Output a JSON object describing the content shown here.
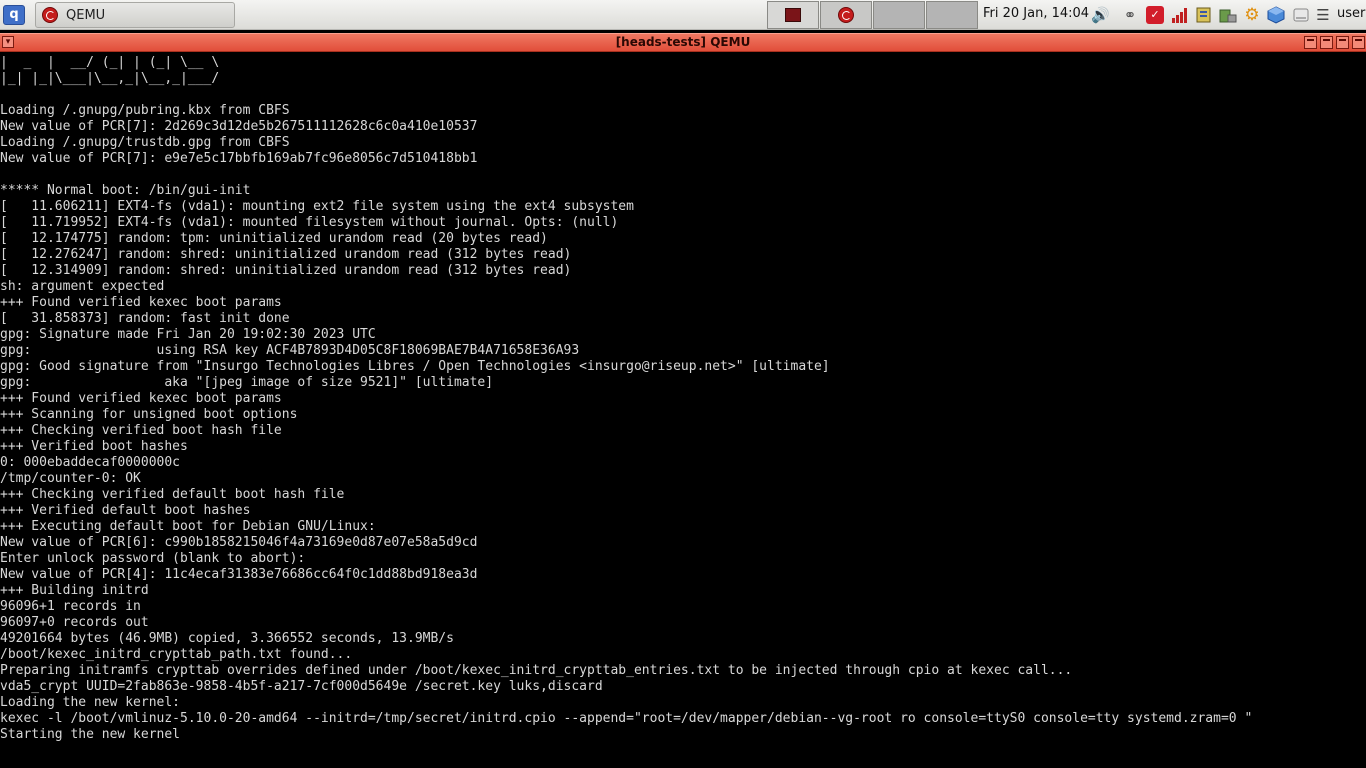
{
  "taskbar": {
    "menu_icon": "q",
    "task": {
      "label": "QEMU",
      "icon": "qemu-logo-icon"
    },
    "clock": "Fri 20 Jan, 14:04",
    "tray_icons": [
      "volume-icon",
      "lock-icon",
      "shield-icon",
      "network-signal-icon",
      "clipboard-icon",
      "keyboard-icon",
      "settings-gear-icon",
      "package-icon",
      "drive-icon",
      "list-icon"
    ],
    "user": "user"
  },
  "window": {
    "title": "[heads-tests] QEMU"
  },
  "terminal": {
    "lines": [
      "|  _  |  __/ (_| | (_| \\__ \\",
      "|_| |_|\\___|\\__,_|\\__,_|___/",
      "",
      "Loading /.gnupg/pubring.kbx from CBFS",
      "New value of PCR[7]: 2d269c3d12de5b267511112628c6c0a410e10537",
      "Loading /.gnupg/trustdb.gpg from CBFS",
      "New value of PCR[7]: e9e7e5c17bbfb169ab7fc96e8056c7d510418bb1",
      "",
      "***** Normal boot: /bin/gui-init",
      "[   11.606211] EXT4-fs (vda1): mounting ext2 file system using the ext4 subsystem",
      "[   11.719952] EXT4-fs (vda1): mounted filesystem without journal. Opts: (null)",
      "[   12.174775] random: tpm: uninitialized urandom read (20 bytes read)",
      "[   12.276247] random: shred: uninitialized urandom read (312 bytes read)",
      "[   12.314909] random: shred: uninitialized urandom read (312 bytes read)",
      "sh: argument expected",
      "+++ Found verified kexec boot params",
      "[   31.858373] random: fast init done",
      "gpg: Signature made Fri Jan 20 19:02:30 2023 UTC",
      "gpg:                using RSA key ACF4B7893D4D05C8F18069BAE7B4A71658E36A93",
      "gpg: Good signature from \"Insurgo Technologies Libres / Open Technologies <insurgo@riseup.net>\" [ultimate]",
      "gpg:                 aka \"[jpeg image of size 9521]\" [ultimate]",
      "+++ Found verified kexec boot params",
      "+++ Scanning for unsigned boot options",
      "+++ Checking verified boot hash file",
      "+++ Verified boot hashes",
      "0: 000ebaddecaf0000000c",
      "/tmp/counter-0: OK",
      "+++ Checking verified default boot hash file",
      "+++ Verified default boot hashes",
      "+++ Executing default boot for Debian GNU/Linux:",
      "New value of PCR[6]: c990b1858215046f4a73169e0d87e07e58a5d9cd",
      "Enter unlock password (blank to abort):",
      "New value of PCR[4]: 11c4ecaf31383e76686cc64f0c1dd88bd918ea3d",
      "+++ Building initrd",
      "96096+1 records in",
      "96097+0 records out",
      "49201664 bytes (46.9MB) copied, 3.366552 seconds, 13.9MB/s",
      "/boot/kexec_initrd_crypttab_path.txt found...",
      "Preparing initramfs crypttab overrides defined under /boot/kexec_initrd_crypttab_entries.txt to be injected through cpio at kexec call...",
      "vda5_crypt UUID=2fab863e-9858-4b5f-a217-7cf000d5649e /secret.key luks,discard",
      "Loading the new kernel:",
      "kexec -l /boot/vmlinuz-5.10.0-20-amd64 --initrd=/tmp/secret/initrd.cpio --append=\"root=/dev/mapper/debian--vg-root ro console=ttyS0 console=tty systemd.zram=0 \"",
      "Starting the new kernel",
      "",
      "_"
    ]
  }
}
